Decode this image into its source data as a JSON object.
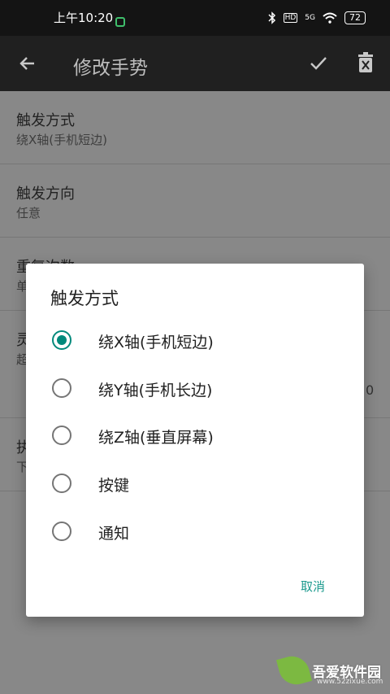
{
  "status_bar": {
    "time": "上午10:20",
    "battery": "72",
    "network": "5G"
  },
  "app_bar": {
    "title": "修改手势"
  },
  "settings": [
    {
      "title": "触发方式",
      "subtitle": "绕X轴(手机短边)"
    },
    {
      "title": "触发方向",
      "subtitle": "任意"
    },
    {
      "title": "重复次数",
      "subtitle": "单"
    },
    {
      "title": "灵",
      "subtitle": "超"
    },
    {
      "title": "执",
      "subtitle": "下"
    }
  ],
  "background_value": "0",
  "dialog": {
    "title": "触发方式",
    "selected_index": 0,
    "options": [
      "绕X轴(手机短边)",
      "绕Y轴(手机长边)",
      "绕Z轴(垂直屏幕)",
      "按键",
      "通知"
    ],
    "cancel_label": "取消"
  },
  "watermark": {
    "name": "吾爱软件园",
    "url": "www.52zixue.com"
  },
  "colors": {
    "accent": "#00897b",
    "appbar": "#202020",
    "statusbar": "#141414"
  }
}
